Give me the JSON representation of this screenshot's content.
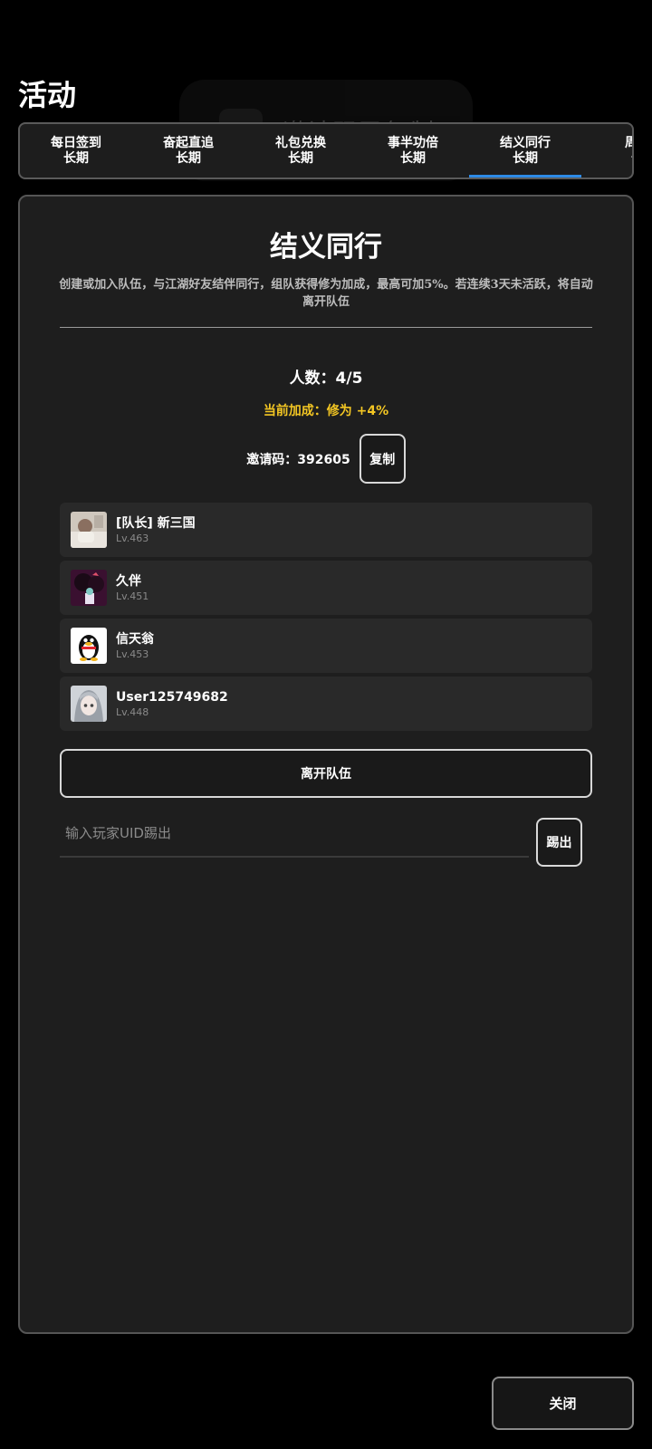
{
  "page": {
    "title": "活动"
  },
  "toast": {
    "logo_text": "小说机",
    "message": "邀请码已复制"
  },
  "tabs": [
    {
      "name": "每日签到",
      "sub": "长期"
    },
    {
      "name": "奋起直追",
      "sub": "长期"
    },
    {
      "name": "礼包兑换",
      "sub": "长期"
    },
    {
      "name": "事半功倍",
      "sub": "长期"
    },
    {
      "name": "结义同行",
      "sub": "长期",
      "active": true
    },
    {
      "name": "周常",
      "sub": "长"
    }
  ],
  "panel": {
    "title": "结义同行",
    "description": "创建或加入队伍，与江湖好友结伴同行，组队获得修为加成，最高可加5%。若连续3天未活跃，将自动离开队伍",
    "count_text": "人数：4/5",
    "bonus_text": "当前加成：修为 +4%",
    "invite_label": "邀请码：392605",
    "copy_label": "复制",
    "leave_label": "离开队伍",
    "kick_placeholder": "输入玩家UID踢出",
    "kick_label": "踢出"
  },
  "members": [
    {
      "name": "[队长] 新三国",
      "level": "Lv.463",
      "avatar": "photo-avatar"
    },
    {
      "name": "久伴",
      "level": "Lv.451",
      "avatar": "anime-avatar"
    },
    {
      "name": "信天翁",
      "level": "Lv.453",
      "avatar": "penguin-avatar"
    },
    {
      "name": "User125749682",
      "level": "Lv.448",
      "avatar": "gray-hair-anime-avatar"
    }
  ],
  "footer": {
    "close_label": "关闭"
  },
  "colors": {
    "accent": "#2d8ae6",
    "bonus": "#f3c623",
    "panel_bg": "#1e1e1e"
  }
}
